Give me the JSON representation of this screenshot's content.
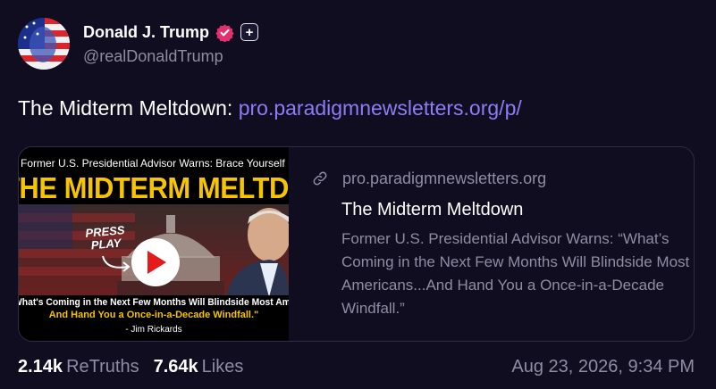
{
  "author": {
    "display_name": "Donald J. Trump",
    "handle": "@realDonaldTrump",
    "verified_icon": "verified-badge-icon",
    "plus_icon": "plus-icon",
    "plus_glyph": "+",
    "accent_color": "#e1306c"
  },
  "post": {
    "text": "The Midterm Meltdown: ",
    "link_text": "pro.paradigmnewsletters.org/p/",
    "link_color": "#8e7cf7"
  },
  "link_card": {
    "domain": "pro.paradigmnewsletters.org",
    "title": "The Midterm Meltdown",
    "description": "Former U.S. Presidential Advisor Warns: “What’s Coming in the Next Few Months Will Blindside Most Americans...And Hand You a Once-in-a-Decade Windfall.”",
    "thumbnail": {
      "top_line": "Former U.S. Presidential Advisor Warns: Brace Yourself For...",
      "headline": "THE MIDTERM MELTDOWN",
      "press_play_line1": "PRESS",
      "press_play_line2": "PLAY",
      "bottom_line1": "What's Coming in the Next Few Months Will Blindside Most Americans...",
      "bottom_line2": "And Hand You a Once-in-a-Decade Windfall.\"",
      "attribution": "- Jim Rickards"
    }
  },
  "stats": {
    "retruths_count": "2.14k",
    "retruths_label": "ReTruths",
    "likes_count": "7.64k",
    "likes_label": "Likes"
  },
  "timestamp": "Aug 23, 2026, 9:34 PM"
}
